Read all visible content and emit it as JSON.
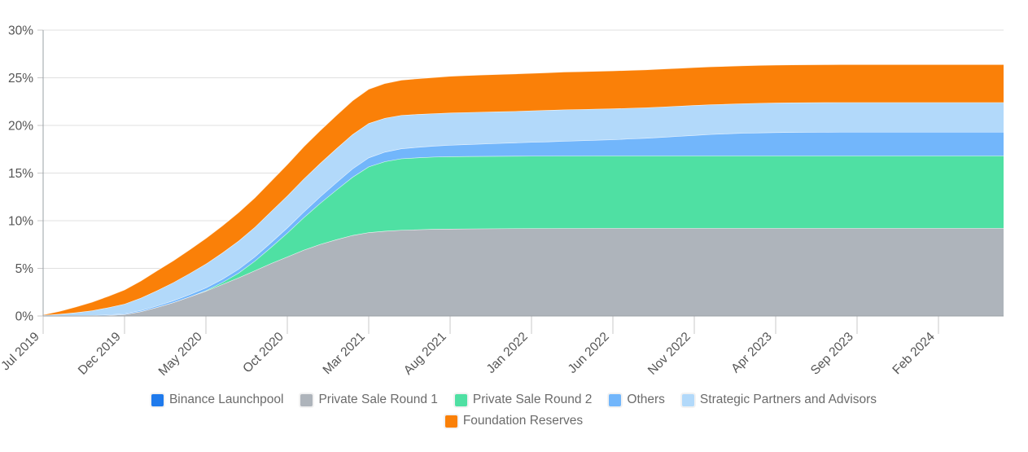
{
  "chart_data": {
    "type": "area",
    "stacked": true,
    "title": "",
    "subtitle": "",
    "xlabel": "",
    "ylabel": "",
    "ylim": [
      0,
      30
    ],
    "y_unit": "%",
    "grid": true,
    "legend_position": "bottom",
    "y_ticks": [
      "0%",
      "5%",
      "10%",
      "15%",
      "20%",
      "25%",
      "30%"
    ],
    "y_tick_values": [
      0,
      5,
      10,
      15,
      20,
      25,
      30
    ],
    "x_ticks": [
      "Jul 2019",
      "Dec 2019",
      "May 2020",
      "Oct 2020",
      "Mar 2021",
      "Aug 2021",
      "Jan 2022",
      "Jun 2022",
      "Nov 2022",
      "Apr 2023",
      "Sep 2023",
      "Feb 2024"
    ],
    "x_tick_index": [
      0,
      5,
      10,
      15,
      20,
      25,
      30,
      35,
      40,
      45,
      50,
      55
    ],
    "x": [
      "Jul 2019",
      "Aug 2019",
      "Sep 2019",
      "Oct 2019",
      "Nov 2019",
      "Dec 2019",
      "Jan 2020",
      "Feb 2020",
      "Mar 2020",
      "Apr 2020",
      "May 2020",
      "Jun 2020",
      "Jul 2020",
      "Aug 2020",
      "Sep 2020",
      "Oct 2020",
      "Nov 2020",
      "Dec 2020",
      "Jan 2021",
      "Feb 2021",
      "Mar 2021",
      "Apr 2021",
      "May 2021",
      "Jun 2021",
      "Jul 2021",
      "Aug 2021",
      "Sep 2021",
      "Oct 2021",
      "Nov 2021",
      "Dec 2021",
      "Jan 2022",
      "Feb 2022",
      "Mar 2022",
      "Apr 2022",
      "May 2022",
      "Jun 2022",
      "Jul 2022",
      "Aug 2022",
      "Sep 2022",
      "Oct 2022",
      "Nov 2022",
      "Dec 2022",
      "Jan 2023",
      "Feb 2023",
      "Mar 2023",
      "Apr 2023",
      "May 2023",
      "Jun 2023",
      "Jul 2023",
      "Aug 2023",
      "Sep 2023",
      "Oct 2023",
      "Nov 2023",
      "Dec 2023",
      "Jan 2024",
      "Feb 2024",
      "Mar 2024",
      "Apr 2024",
      "May 2024",
      "Jun 2024"
    ],
    "series": [
      {
        "name": "Binance Launchpool",
        "color": "#1f7aec",
        "values": [
          0.02,
          0.02,
          0.02,
          0.02,
          0.02,
          0.02,
          0.02,
          0.02,
          0.02,
          0.02,
          0.02,
          0.02,
          0.02,
          0.02,
          0.02,
          0.02,
          0.02,
          0.02,
          0.02,
          0.02,
          0.02,
          0.02,
          0.02,
          0.02,
          0.02,
          0.02,
          0.02,
          0.02,
          0.02,
          0.02,
          0.02,
          0.02,
          0.02,
          0.02,
          0.02,
          0.02,
          0.02,
          0.02,
          0.02,
          0.02,
          0.02,
          0.02,
          0.02,
          0.02,
          0.02,
          0.02,
          0.02,
          0.02,
          0.02,
          0.02,
          0.02,
          0.02,
          0.02,
          0.02,
          0.02,
          0.02,
          0.02,
          0.02,
          0.02,
          0.02
        ]
      },
      {
        "name": "Private Sale Round 1",
        "color": "#aeb4bb",
        "values": [
          0.0,
          0.0,
          0.0,
          0.0,
          0.05,
          0.15,
          0.45,
          0.9,
          1.4,
          2.0,
          2.6,
          3.3,
          4.0,
          4.75,
          5.5,
          6.2,
          6.9,
          7.5,
          8.0,
          8.45,
          8.75,
          8.9,
          9.0,
          9.05,
          9.1,
          9.12,
          9.14,
          9.15,
          9.16,
          9.17,
          9.18,
          9.18,
          9.19,
          9.19,
          9.2,
          9.2,
          9.2,
          9.2,
          9.2,
          9.2,
          9.2,
          9.2,
          9.2,
          9.2,
          9.2,
          9.2,
          9.2,
          9.2,
          9.2,
          9.2,
          9.2,
          9.2,
          9.2,
          9.2,
          9.2,
          9.2,
          9.2,
          9.2,
          9.2,
          9.2
        ]
      },
      {
        "name": "Private Sale Round 2",
        "color": "#4fe0a3",
        "values": [
          0.0,
          0.0,
          0.0,
          0.0,
          0.0,
          0.0,
          0.0,
          0.0,
          0.0,
          0.0,
          0.05,
          0.2,
          0.5,
          1.0,
          1.7,
          2.5,
          3.4,
          4.3,
          5.2,
          6.1,
          6.9,
          7.3,
          7.5,
          7.55,
          7.58,
          7.6,
          7.6,
          7.6,
          7.6,
          7.6,
          7.6,
          7.6,
          7.6,
          7.6,
          7.6,
          7.6,
          7.6,
          7.6,
          7.6,
          7.6,
          7.6,
          7.6,
          7.6,
          7.6,
          7.6,
          7.6,
          7.6,
          7.6,
          7.6,
          7.6,
          7.6,
          7.6,
          7.6,
          7.6,
          7.6,
          7.6,
          7.6,
          7.6,
          7.6,
          7.6
        ]
      },
      {
        "name": "Others",
        "color": "#72b6fb",
        "values": [
          0.02,
          0.03,
          0.04,
          0.05,
          0.07,
          0.09,
          0.12,
          0.15,
          0.2,
          0.25,
          0.3,
          0.35,
          0.4,
          0.45,
          0.5,
          0.55,
          0.6,
          0.68,
          0.78,
          0.88,
          0.95,
          1.0,
          1.05,
          1.1,
          1.15,
          1.2,
          1.25,
          1.3,
          1.35,
          1.4,
          1.45,
          1.5,
          1.55,
          1.6,
          1.65,
          1.7,
          1.78,
          1.85,
          1.95,
          2.05,
          2.15,
          2.25,
          2.32,
          2.38,
          2.42,
          2.45,
          2.47,
          2.48,
          2.49,
          2.5,
          2.5,
          2.5,
          2.5,
          2.5,
          2.5,
          2.5,
          2.5,
          2.5,
          2.5,
          2.5
        ]
      },
      {
        "name": "Strategic Partners and Advisors",
        "color": "#b2d9fa",
        "values": [
          0.05,
          0.15,
          0.3,
          0.5,
          0.75,
          1.0,
          1.3,
          1.6,
          1.9,
          2.2,
          2.5,
          2.75,
          2.95,
          3.1,
          3.25,
          3.35,
          3.45,
          3.5,
          3.55,
          3.6,
          3.6,
          3.55,
          3.5,
          3.45,
          3.4,
          3.38,
          3.36,
          3.34,
          3.32,
          3.3,
          3.3,
          3.3,
          3.3,
          3.28,
          3.26,
          3.24,
          3.22,
          3.2,
          3.18,
          3.16,
          3.14,
          3.12,
          3.1,
          3.1,
          3.1,
          3.1,
          3.1,
          3.1,
          3.1,
          3.1,
          3.1,
          3.1,
          3.1,
          3.1,
          3.1,
          3.1,
          3.1,
          3.1,
          3.1,
          3.1
        ]
      },
      {
        "name": "Foundation Reserves",
        "color": "#fa8008",
        "values": [
          0.05,
          0.3,
          0.6,
          0.9,
          1.2,
          1.5,
          1.8,
          2.1,
          2.3,
          2.5,
          2.7,
          2.85,
          3.0,
          3.1,
          3.2,
          3.3,
          3.4,
          3.45,
          3.5,
          3.55,
          3.6,
          3.65,
          3.7,
          3.75,
          3.8,
          3.85,
          3.88,
          3.9,
          3.92,
          3.93,
          3.94,
          3.95,
          3.96,
          3.97,
          3.97,
          3.98,
          3.98,
          3.98,
          3.98,
          3.98,
          3.98,
          3.98,
          3.98,
          3.98,
          3.98,
          3.98,
          3.98,
          3.98,
          3.98,
          3.98,
          3.98,
          3.98,
          3.98,
          3.98,
          3.98,
          3.98,
          3.98,
          3.98,
          3.98,
          3.98
        ]
      }
    ],
    "totals_note": {
      "final_total": "26.6%",
      "final_cumulative": [
        "0.02%",
        "9.2%",
        "16.8%",
        "19.3%",
        "22.4%",
        "26.4%"
      ]
    }
  },
  "legend": {
    "rows": [
      [
        {
          "label": "Binance Launchpool",
          "color": "#1f7aec"
        },
        {
          "label": "Private Sale Round 1",
          "color": "#aeb4bb"
        },
        {
          "label": "Private Sale Round 2",
          "color": "#4fe0a3"
        },
        {
          "label": "Others",
          "color": "#72b6fb"
        },
        {
          "label": "Strategic Partners and Advisors",
          "color": "#b2d9fa"
        }
      ],
      [
        {
          "label": "Foundation Reserves",
          "color": "#fa8008"
        }
      ]
    ]
  },
  "axes": {
    "y_axis_name": "y-axis",
    "x_axis_name": "x-axis"
  }
}
